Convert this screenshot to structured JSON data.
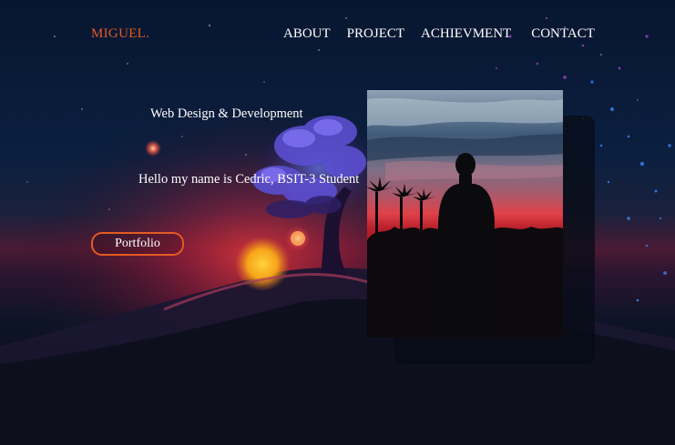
{
  "nav": {
    "logo": "MIGUEL.",
    "links": [
      "ABOUT",
      "PROJECT",
      "ACHIEVMENT",
      "CONTACT"
    ]
  },
  "hero": {
    "subtitle": "Web Design & Development",
    "intro": "Hello my name is Cedric, BSIT-3 Student",
    "button_label": "Portfolio"
  },
  "colors": {
    "accent": "#e45a22",
    "text": "#ffffff",
    "background": "#07111f"
  },
  "images": {
    "background": "night-sky-tree-sunset-scene",
    "portrait": "person-silhouette-at-sunset-with-palm-trees"
  }
}
